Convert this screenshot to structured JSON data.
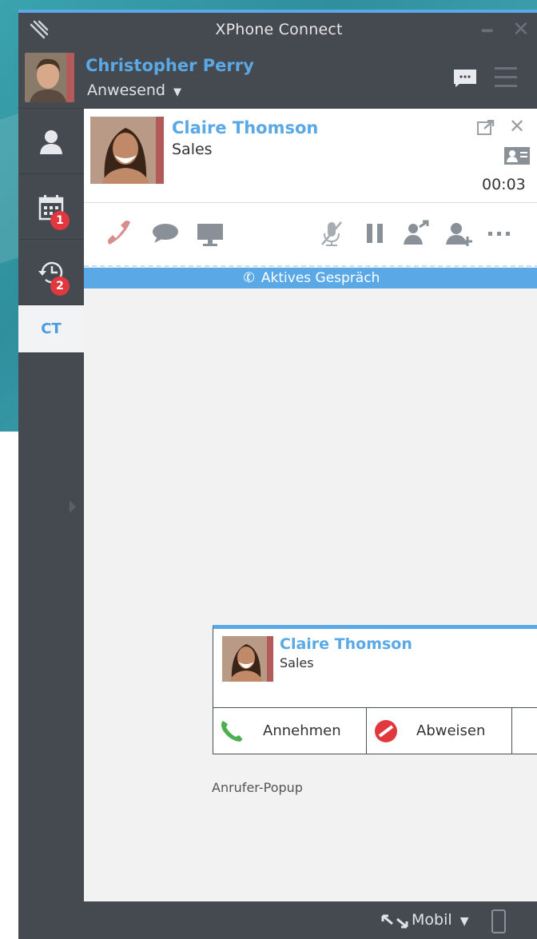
{
  "window": {
    "title": "XPhone Connect"
  },
  "user": {
    "name": "Christopher Perry",
    "status": "Anwesend"
  },
  "sidebar": {
    "items": [
      {
        "icon": "contact-icon"
      },
      {
        "icon": "calendar-icon",
        "badge": "1"
      },
      {
        "icon": "history-icon",
        "badge": "2"
      },
      {
        "label": "CT"
      }
    ]
  },
  "call": {
    "contact_name": "Claire Thomson",
    "contact_dept": "Sales",
    "timer": "00:03",
    "active_label": "Aktives Gespräch"
  },
  "popup": {
    "name": "Claire Thomson",
    "dept": "Sales",
    "accept_label": "Annehmen",
    "reject_label": "Abweisen",
    "caption": "Anrufer-Popup"
  },
  "bottombar": {
    "mode": "Mobil"
  },
  "colors": {
    "accent": "#5aa9e6",
    "badge": "#e0383e",
    "hangup": "#d9534f",
    "accept": "#4caf50"
  }
}
